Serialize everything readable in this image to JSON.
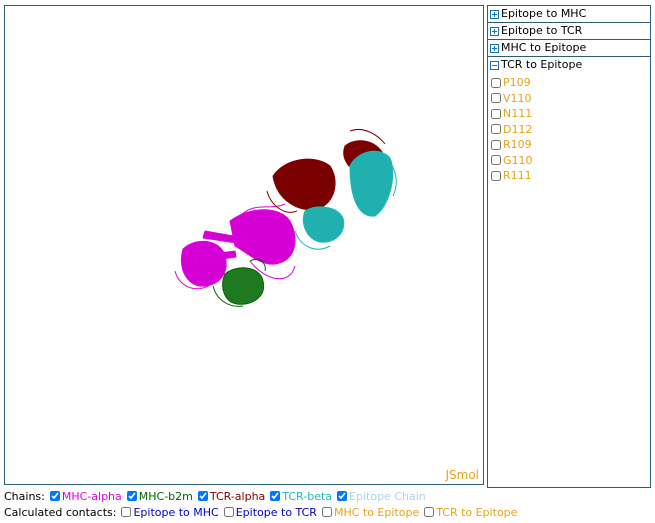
{
  "viewer": {
    "label": "JSmol"
  },
  "panel": {
    "sections": [
      {
        "title": "Epitope to MHC",
        "expanded": false
      },
      {
        "title": "Epitope to TCR",
        "expanded": false
      },
      {
        "title": "MHC to Epitope",
        "expanded": false
      },
      {
        "title": "TCR to Epitope",
        "expanded": true
      }
    ],
    "tcr_to_epitope_items": [
      "P109",
      "V110",
      "N111",
      "D112",
      "R109",
      "G110",
      "R111"
    ],
    "item_color": "#e8a317"
  },
  "chains": {
    "label": "Chains:",
    "items": [
      {
        "name": "MHC-alpha",
        "color": "#e000e0",
        "checked": true
      },
      {
        "name": "MHC-b2m",
        "color": "#006400",
        "checked": true
      },
      {
        "name": "TCR-alpha",
        "color": "#800000",
        "checked": true
      },
      {
        "name": "TCR-beta",
        "color": "#1fb8b8",
        "checked": true
      },
      {
        "name": "Epitope Chain",
        "color": "#aad4e6",
        "checked": true
      }
    ]
  },
  "contacts": {
    "label": "Calculated contacts:",
    "items": [
      {
        "name": "Epitope to MHC",
        "color": "#0000cc",
        "checked": false
      },
      {
        "name": "Epitope to TCR",
        "color": "#0000cc",
        "checked": false
      },
      {
        "name": "MHC to Epitope",
        "color": "#e8a317",
        "checked": false
      },
      {
        "name": "TCR to Epitope",
        "color": "#e8a317",
        "checked": false
      }
    ]
  }
}
